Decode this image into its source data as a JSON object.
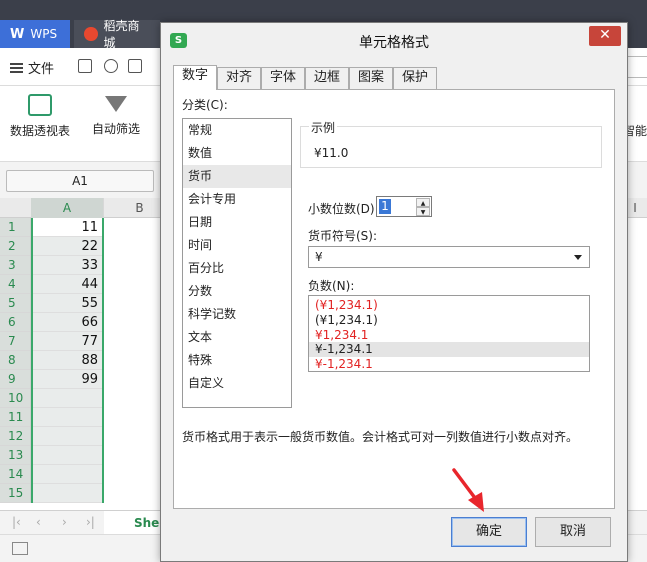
{
  "app": {
    "tabs": [
      {
        "label": "WPS"
      },
      {
        "label": "稻壳商城"
      }
    ],
    "file_menu": "文件",
    "ribbon": {
      "pivot_table": "数据透视表",
      "auto_filter": "自动筛选",
      "smart_partial": "智能"
    },
    "name_box": "A1",
    "columns": [
      "A",
      "B",
      "I"
    ],
    "rows": [
      "1",
      "2",
      "3",
      "4",
      "5",
      "6",
      "7",
      "8",
      "9",
      "10",
      "11",
      "12",
      "13",
      "14",
      "15"
    ],
    "cells_A": [
      "11",
      "22",
      "33",
      "44",
      "55",
      "66",
      "77",
      "88",
      "99",
      "",
      "",
      "",
      "",
      "",
      ""
    ],
    "sheet_tab": "Shee"
  },
  "dialog": {
    "title": "单元格格式",
    "close": "✕",
    "tabs": [
      {
        "label": "数字",
        "active": true
      },
      {
        "label": "对齐"
      },
      {
        "label": "字体"
      },
      {
        "label": "边框"
      },
      {
        "label": "图案"
      },
      {
        "label": "保护"
      }
    ],
    "category_label": "分类(C):",
    "categories": [
      "常规",
      "数值",
      "货币",
      "会计专用",
      "日期",
      "时间",
      "百分比",
      "分数",
      "科学记数",
      "文本",
      "特殊",
      "自定义"
    ],
    "selected_category": "货币",
    "sample_label": "示例",
    "sample_value": "¥11.0",
    "decimal_label": "小数位数(D):",
    "decimal_value": "1",
    "symbol_label": "货币符号(S):",
    "symbol_value": "¥",
    "negative_label": "负数(N):",
    "negative_options": [
      {
        "text": "(¥1,234.1)",
        "color": "#e22222"
      },
      {
        "text": "(¥1,234.1)",
        "color": "#222222"
      },
      {
        "text": "¥1,234.1",
        "color": "#e22222"
      },
      {
        "text": "¥-1,234.1",
        "color": "#222222",
        "selected": true
      },
      {
        "text": "¥-1,234.1",
        "color": "#e22222"
      }
    ],
    "description": "货币格式用于表示一般货币数值。会计格式可对一列数值进行小数点对齐。",
    "ok_label": "确定",
    "cancel_label": "取消"
  },
  "colors": {
    "accent_green": "#2a8a4f",
    "pointer_red": "#e8262c",
    "selection_blue": "#3a78d6"
  }
}
